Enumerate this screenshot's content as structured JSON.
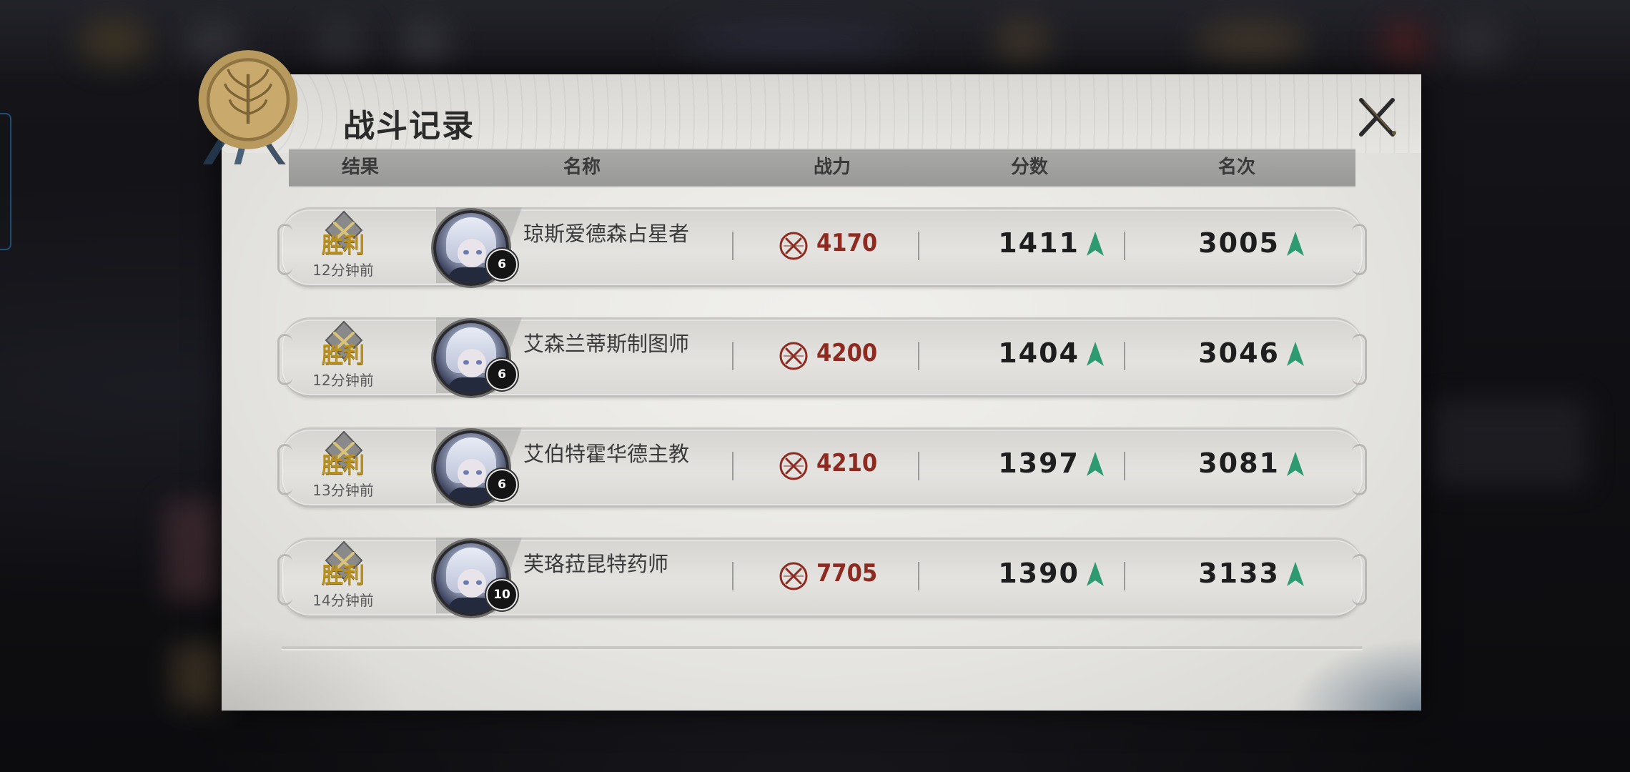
{
  "dialog": {
    "title": "战斗记录",
    "close_icon": "close-x-icon"
  },
  "columns": {
    "result": "结果",
    "name": "名称",
    "power": "战力",
    "score": "分数",
    "rank": "名次"
  },
  "records": [
    {
      "result": "胜利",
      "time": "12分钟前",
      "level": "6",
      "name": "琼斯爱德森占星者",
      "power": "4170",
      "score": "1411",
      "rank": "3005",
      "trend": "up"
    },
    {
      "result": "胜利",
      "time": "12分钟前",
      "level": "6",
      "name": "艾森兰蒂斯制图师",
      "power": "4200",
      "score": "1404",
      "rank": "3046",
      "trend": "up"
    },
    {
      "result": "胜利",
      "time": "13分钟前",
      "level": "6",
      "name": "艾伯特霍华德主教",
      "power": "4210",
      "score": "1397",
      "rank": "3081",
      "trend": "up"
    },
    {
      "result": "胜利",
      "time": "14分钟前",
      "level": "10",
      "name": "芙珞菈昆特药师",
      "power": "7705",
      "score": "1390",
      "rank": "3133",
      "trend": "up"
    }
  ],
  "colors": {
    "victory_gold": "#b8901f",
    "power_red": "#8e2a20",
    "trend_up_green": "#2e9a72",
    "panel_bg": "#e6e5e1"
  }
}
